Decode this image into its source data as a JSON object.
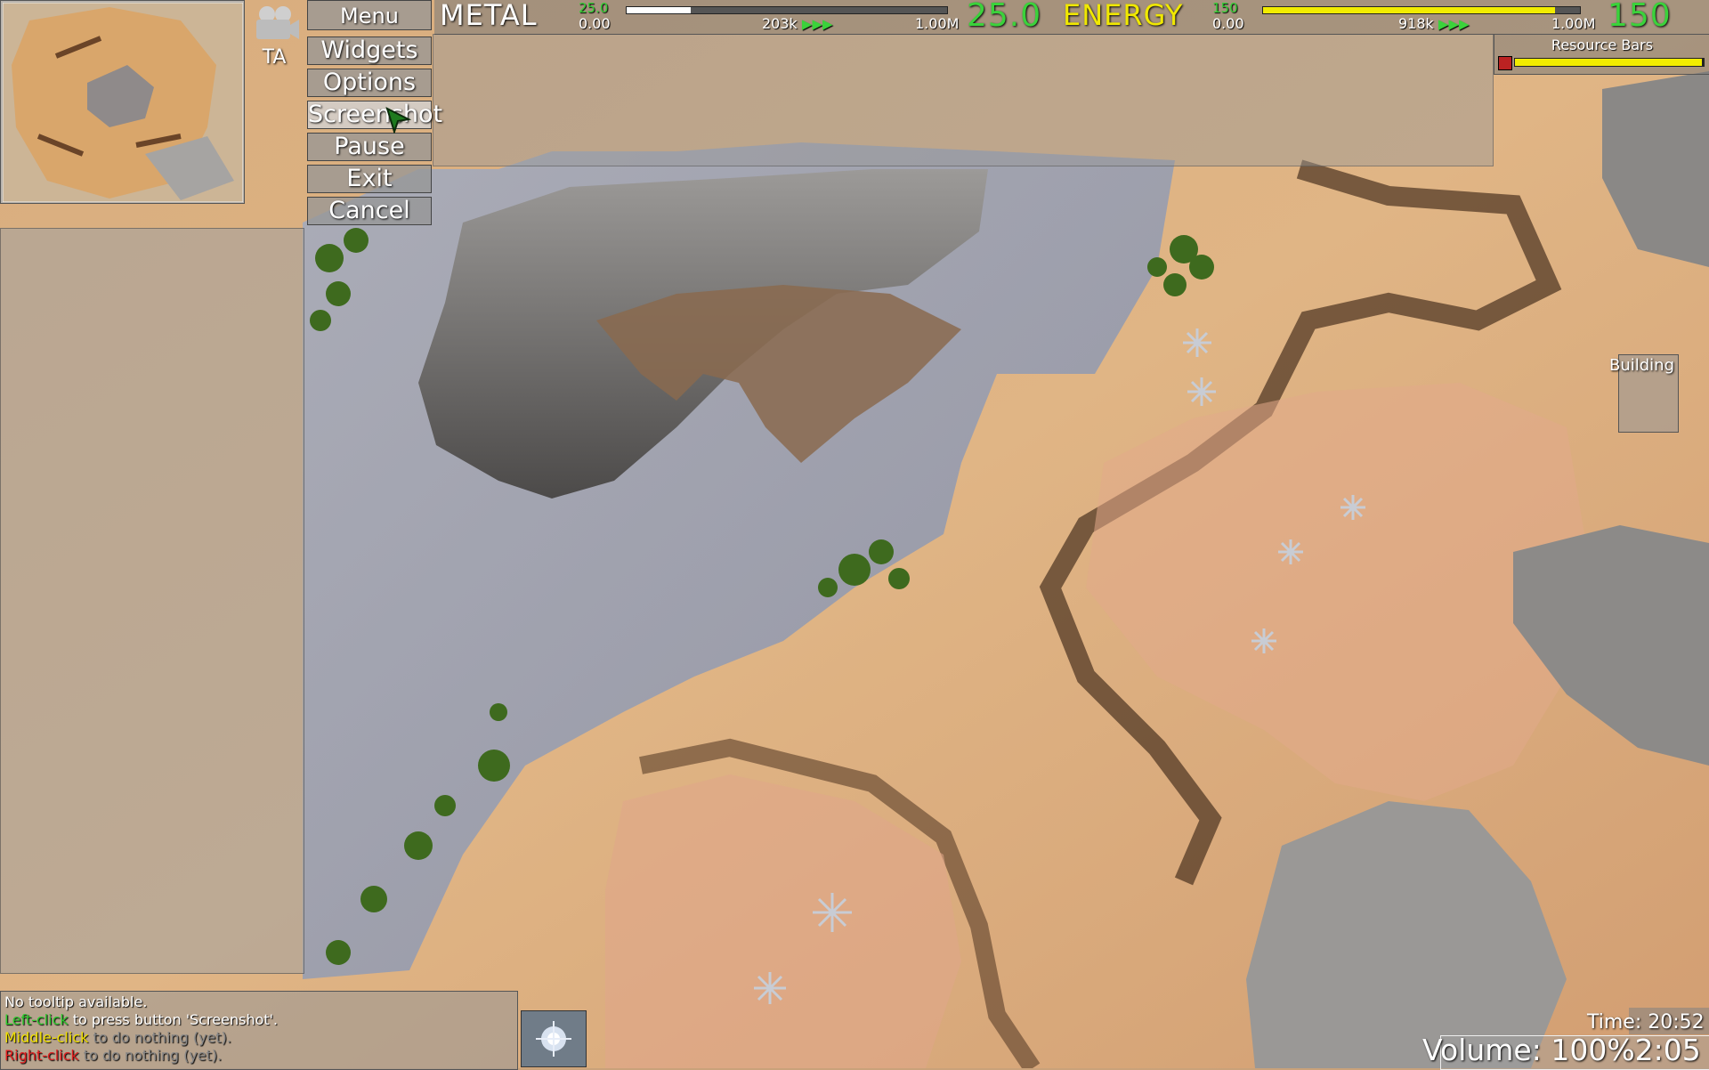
{
  "hud": {
    "faction_label": "TA",
    "menu": {
      "title": "Menu",
      "items": [
        "Widgets",
        "Options",
        "Screenshot",
        "Pause",
        "Exit",
        "Cancel"
      ],
      "hovered": "Screenshot"
    },
    "metal": {
      "name": "METAL",
      "income_small": "25.0",
      "expense_small": "0.00",
      "storage_text": "203k",
      "max_text": "1.00M",
      "amount_big": "25.0",
      "fill_fraction": 0.2
    },
    "energy": {
      "name": "ENERGY",
      "income_small": "150",
      "expense_small": "0.00",
      "storage_text": "918k",
      "max_text": "1.00M",
      "amount_big": "150",
      "fill_fraction": 0.92
    },
    "arrows": "▶▶▶",
    "resource_bars_widget": {
      "title": "Resource Bars",
      "fill_fraction": 0.99
    },
    "building_tab": "Building",
    "tooltip": {
      "line1": "No tooltip available.",
      "line2_key": "Left-click",
      "line2_rest": " to press button 'Screenshot'.",
      "line3_key": "Middle-click",
      "line3_rest": " to do nothing (yet).",
      "line4_key": "Right-click",
      "line4_rest": " to do nothing (yet)."
    },
    "time": "Time: 20:52",
    "volume": "Volume: 100%2:05"
  },
  "colors": {
    "green": "#3bd23b",
    "energy_yellow": "#f0e800",
    "panel_grey": "#a0a0a0"
  }
}
